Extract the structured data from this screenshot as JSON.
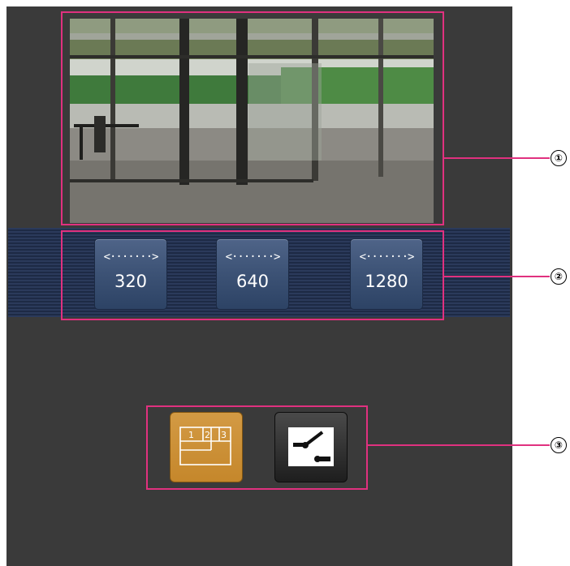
{
  "camera": {
    "description_label": "Live image"
  },
  "resolution_buttons": [
    {
      "arrow": "<·······>",
      "label": "320"
    },
    {
      "arrow": "<·······>",
      "label": "640"
    },
    {
      "arrow": "<·······>",
      "label": "1280"
    }
  ],
  "control_buttons": {
    "multiscreen_digits": [
      "1",
      "2",
      "3"
    ],
    "multiscreen_icon": "multiscreen-icon",
    "control_icon": "slider-control-icon"
  },
  "callouts": [
    "①",
    "②",
    "③"
  ],
  "colors": {
    "background": "#3a3a3a",
    "callout": "#e0317f",
    "resolution_button": "#3c5275",
    "multiscreen_button": "#c5872b",
    "control_button": "#2a2a2a"
  }
}
